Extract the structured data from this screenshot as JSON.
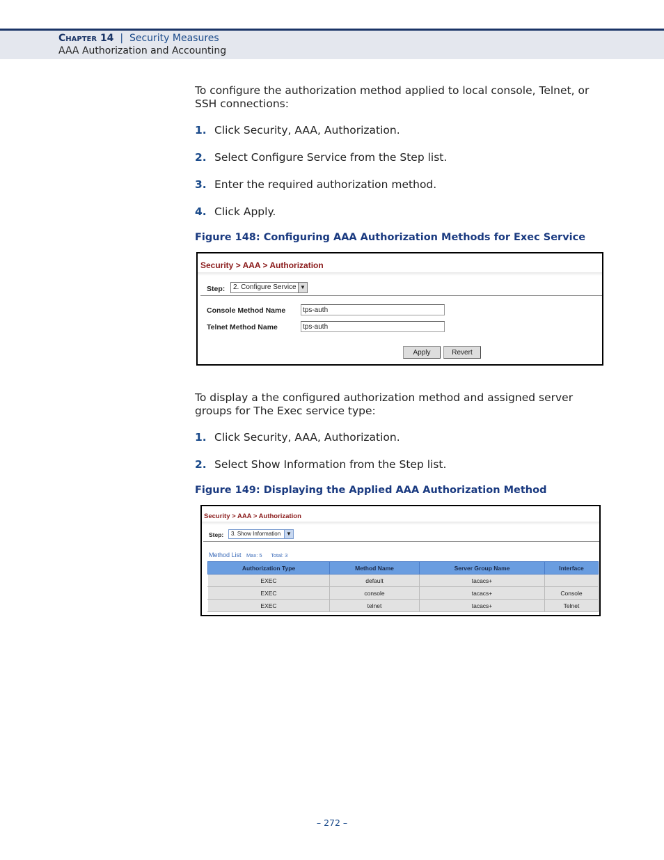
{
  "header": {
    "chapter": "Chapter 14",
    "separator": "|",
    "section": "Security Measures",
    "subtitle": "AAA Authorization and Accounting"
  },
  "intro1": "To configure the authorization method applied to local console, Telnet, or SSH connections:",
  "steps1": [
    {
      "n": "1.",
      "t": "Click Security, AAA, Authorization."
    },
    {
      "n": "2.",
      "t": "Select Configure Service from the Step list."
    },
    {
      "n": "3.",
      "t": "Enter the required authorization method."
    },
    {
      "n": "4.",
      "t": "Click Apply."
    }
  ],
  "fig148": {
    "caption": "Figure 148:  Configuring AAA Authorization Methods for Exec Service",
    "breadcrumb": "Security > AAA > Authorization",
    "step_label": "Step:",
    "step_value": "2. Configure Service",
    "console_label": "Console Method Name",
    "console_value": "tps-auth",
    "telnet_label": "Telnet Method Name",
    "telnet_value": "tps-auth",
    "apply": "Apply",
    "revert": "Revert"
  },
  "intro2": "To display a the configured authorization method and assigned server groups for The Exec service type:",
  "steps2": [
    {
      "n": "1.",
      "t": "Click Security, AAA, Authorization."
    },
    {
      "n": "2.",
      "t": "Select Show Information from the Step list."
    }
  ],
  "fig149": {
    "caption": "Figure 149:  Displaying the Applied AAA Authorization Method",
    "breadcrumb": "Security > AAA > Authorization",
    "step_label": "Step:",
    "step_value": "3. Show Information",
    "list_title": "Method List",
    "max": "Max: 5",
    "total": "Total: 3",
    "columns": [
      "Authorization Type",
      "Method Name",
      "Server Group Name",
      "Interface"
    ],
    "rows": [
      [
        "EXEC",
        "default",
        "tacacs+",
        ""
      ],
      [
        "EXEC",
        "console",
        "tacacs+",
        "Console"
      ],
      [
        "EXEC",
        "telnet",
        "tacacs+",
        "Telnet"
      ]
    ]
  },
  "page_number": "–  272  –"
}
